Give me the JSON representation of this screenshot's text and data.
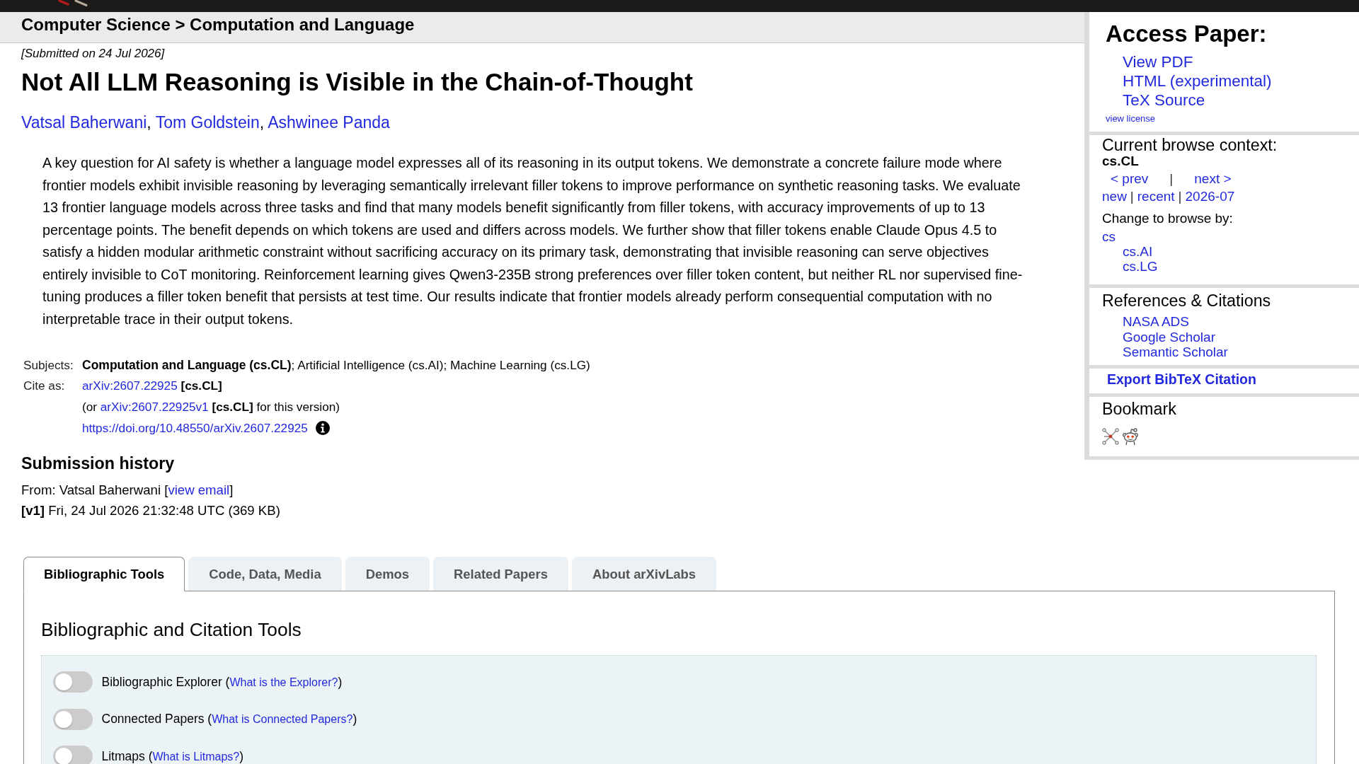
{
  "breadcrumb": "Computer Science > Computation and Language",
  "paper": {
    "submitted": "[Submitted on 24 Jul 2026]",
    "title": "Not All LLM Reasoning is Visible in the Chain-of-Thought",
    "authors": {
      "separator": ",",
      "names": [
        "Vatsal Baherwani",
        "Tom Goldstein",
        "Ashwinee Panda"
      ]
    },
    "abstract": "A key question for AI safety is whether a language model expresses all of its reasoning in its output tokens. We demonstrate a concrete failure mode where frontier models exhibit invisible reasoning by leveraging semantically irrelevant filler tokens to improve performance on synthetic reasoning tasks. We evaluate 13 frontier language models across three tasks and find that many models benefit significantly from filler tokens, with accuracy improvements of up to 13 percentage points. The benefit depends on which tokens are used and differs across models. We further show that filler tokens enable Claude Opus 4.5 to satisfy a hidden modular arithmetic constraint without sacrificing accuracy on its primary task, demonstrating that invisible reasoning can serve objectives entirely invisible to CoT monitoring. Reinforcement learning gives Qwen3-235B strong preferences over filler token content, but neither RL nor supervised fine-tuning produces a filler token benefit that persists at test time. Our results indicate that frontier models already perform consequential computation with no interpretable trace in their output tokens."
  },
  "metadata": {
    "subjects": {
      "label": "Subjects:",
      "value": "**Computation and Language (cs.CL)**; Artificial Intelligence (cs.AI); Machine Learning (cs.LG)"
    },
    "cite_as": {
      "label": "Cite as:",
      "lines": [
        {
          "parts": [
            {
              "kind": "link",
              "text": "arXiv:2607.22925"
            },
            {
              "kind": "bold",
              "text": " [cs.CL]"
            }
          ]
        },
        {
          "parts": [
            {
              "kind": "text",
              "text": "(or "
            },
            {
              "kind": "link",
              "text": "arXiv:2607.22925v1"
            },
            {
              "kind": "bold",
              "text": " [cs.CL]"
            },
            {
              "kind": "text",
              "text": " for this version)"
            }
          ]
        },
        {
          "parts": [
            {
              "kind": "link",
              "text": "https://doi.org/10.48550/arXiv.2607.22925"
            }
          ],
          "info": true
        }
      ]
    }
  },
  "submission_history": {
    "heading": "Submission history",
    "from": {
      "parts": [
        {
          "kind": "text",
          "text": "From: Vatsal Baherwani ["
        },
        {
          "kind": "link",
          "text": "view email"
        },
        {
          "kind": "text",
          "text": "]"
        }
      ]
    },
    "versions": [
      "**[v1]** Fri, 24 Jul 2026 21:32:48 UTC (369 KB)"
    ]
  },
  "sidebar": {
    "access_paper": {
      "heading": "Access Paper:",
      "links": [
        "View PDF",
        "HTML (experimental)",
        "TeX Source"
      ],
      "license": "view license"
    },
    "browse_context": {
      "heading": "Current browse context:",
      "category": "cs.CL",
      "pager": [
        {
          "kind": "link",
          "text": "< prev"
        },
        {
          "kind": "text",
          "text": "|"
        },
        {
          "kind": "link",
          "text": "next >"
        }
      ],
      "archive": [
        {
          "kind": "link",
          "text": "new"
        },
        {
          "kind": "text",
          "text": "|"
        },
        {
          "kind": "link",
          "text": "recent"
        },
        {
          "kind": "text",
          "text": "|"
        },
        {
          "kind": "link",
          "text": "2026-07"
        }
      ],
      "change_label": "Change to browse by:",
      "categories": [
        {
          "label": "cs",
          "children": [
            {
              "label": "cs.AI"
            },
            {
              "label": "cs.LG"
            }
          ]
        }
      ]
    },
    "references": {
      "heading": "References & Citations",
      "links": [
        "NASA ADS",
        "Google Scholar",
        "Semantic Scholar"
      ]
    },
    "export": "Export BibTeX Citation",
    "bookmark": {
      "heading": "Bookmark"
    }
  },
  "labs": {
    "tabs": [
      {
        "label": "Bibliographic Tools",
        "selected": true
      },
      {
        "label": "Code, Data, Media",
        "selected": false
      },
      {
        "label": "Demos",
        "selected": false
      },
      {
        "label": "Related Papers",
        "selected": false
      },
      {
        "label": "About arXivLabs",
        "selected": false
      }
    ],
    "heading": "Bibliographic and Citation Tools",
    "tools": [
      {
        "parts": [
          {
            "kind": "text",
            "text": "Bibliographic Explorer ("
          },
          {
            "kind": "link",
            "text": "What is the Explorer?"
          },
          {
            "kind": "text",
            "text": ")"
          }
        ],
        "on": false
      },
      {
        "parts": [
          {
            "kind": "text",
            "text": "Connected Papers ("
          },
          {
            "kind": "link",
            "text": "What is Connected Papers?"
          },
          {
            "kind": "text",
            "text": ")"
          }
        ],
        "on": false
      },
      {
        "parts": [
          {
            "kind": "text",
            "text": "Litmaps ("
          },
          {
            "kind": "link",
            "text": "What is Litmaps?"
          },
          {
            "kind": "text",
            "text": ")"
          }
        ],
        "on": false
      }
    ]
  }
}
